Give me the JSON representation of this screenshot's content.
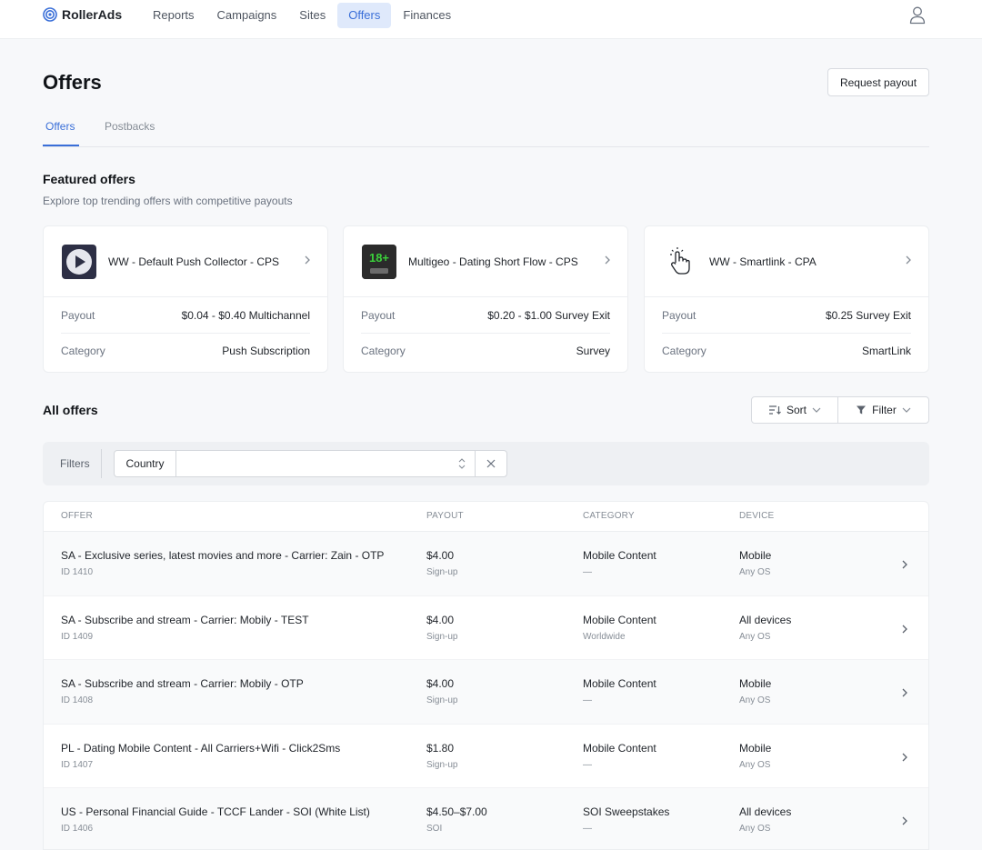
{
  "app": {
    "brand": "RollerAds"
  },
  "nav": {
    "items": [
      {
        "label": "Reports"
      },
      {
        "label": "Campaigns"
      },
      {
        "label": "Sites"
      },
      {
        "label": "Offers",
        "active": true
      },
      {
        "label": "Finances"
      }
    ]
  },
  "page": {
    "title": "Offers",
    "request_payout_label": "Request payout"
  },
  "tabs": [
    {
      "label": "Offers",
      "active": true
    },
    {
      "label": "Postbacks"
    }
  ],
  "featured": {
    "title": "Featured offers",
    "subtitle": "Explore top trending offers with competitive payouts",
    "cards": [
      {
        "name": "WW - Default Push Collector - CPS",
        "icon": "play-icon",
        "payout_label": "Payout",
        "payout": "$0.04 - $0.40 Multichannel",
        "category_label": "Category",
        "category": "Push Subscription"
      },
      {
        "name": "Multigeo - Dating Short Flow - CPS",
        "icon": "dating-18plus-icon",
        "payout_label": "Payout",
        "payout": "$0.20 - $1.00 Survey Exit",
        "category_label": "Category",
        "category": "Survey"
      },
      {
        "name": "WW - Smartlink - CPA",
        "icon": "hand-pointer-icon",
        "payout_label": "Payout",
        "payout": "$0.25 Survey Exit",
        "category_label": "Category",
        "category": "SmartLink"
      }
    ]
  },
  "all_offers": {
    "title": "All offers",
    "sort_label": "Sort",
    "filter_label": "Filter",
    "filters_label": "Filters",
    "country_label": "Country",
    "columns": {
      "offer": "OFFER",
      "payout": "PAYOUT",
      "category": "CATEGORY",
      "device": "DEVICE"
    },
    "rows": [
      {
        "name": "SA - Exclusive series, latest movies and more - Carrier: Zain - OTP",
        "id": "ID 1410",
        "payout": "$4.00",
        "payout_type": "Sign-up",
        "category": "Mobile Content",
        "geo": "—",
        "device": "Mobile",
        "os": "Any OS"
      },
      {
        "name": "SA - Subscribe and stream - Carrier: Mobily - TEST",
        "id": "ID 1409",
        "payout": "$4.00",
        "payout_type": "Sign-up",
        "category": "Mobile Content",
        "geo": "Worldwide",
        "device": "All devices",
        "os": "Any OS"
      },
      {
        "name": "SA - Subscribe and stream - Carrier: Mobily - OTP",
        "id": "ID 1408",
        "payout": "$4.00",
        "payout_type": "Sign-up",
        "category": "Mobile Content",
        "geo": "—",
        "device": "Mobile",
        "os": "Any OS"
      },
      {
        "name": "PL - Dating Mobile Content - All Carriers+Wifi - Click2Sms",
        "id": "ID 1407",
        "payout": "$1.80",
        "payout_type": "Sign-up",
        "category": "Mobile Content",
        "geo": "—",
        "device": "Mobile",
        "os": "Any OS"
      },
      {
        "name": "US - Personal Financial Guide - TCCF Lander - SOI (White List)",
        "id": "ID 1406",
        "payout": "$4.50–$7.00",
        "payout_type": "SOI",
        "category": "SOI Sweepstakes",
        "geo": "—",
        "device": "All devices",
        "os": "Any OS"
      }
    ]
  },
  "colors": {
    "accent": "#3a6fd8",
    "nav_active_bg": "#dfe9fb",
    "page_bg": "#f7f8fa"
  }
}
